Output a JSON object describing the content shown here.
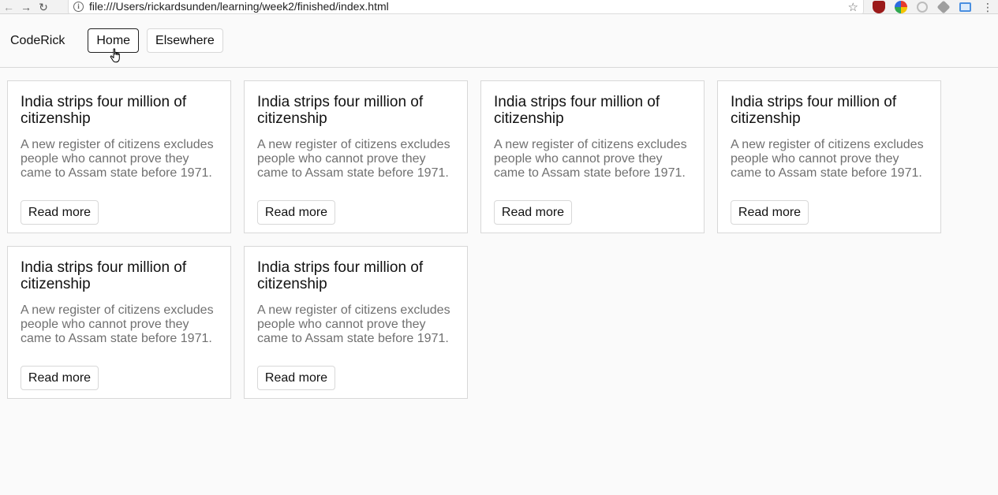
{
  "browser": {
    "url": "file:///Users/rickardsunden/learning/week2/finished/index.html",
    "back_icon": "arrow-left-icon",
    "forward_icon": "arrow-right-icon",
    "reload_icon": "reload-icon",
    "bookmark_icon": "star-icon",
    "menu_icon": "more-vert-icon",
    "extensions": [
      "ublock-icon",
      "color-picker-icon",
      "circle-extension-icon",
      "layers-extension-icon",
      "screen-extension-icon"
    ]
  },
  "header": {
    "brand": "CodeRick",
    "nav": [
      {
        "label": "Home",
        "active": true
      },
      {
        "label": "Elsewhere",
        "active": false
      }
    ]
  },
  "cards": [
    {
      "title": "India strips four million of citizenship",
      "text": "A new register of citizens excludes people who cannot prove they came to Assam state before 1971.",
      "button": "Read more"
    },
    {
      "title": "India strips four million of citizenship",
      "text": "A new register of citizens excludes people who cannot prove they came to Assam state before 1971.",
      "button": "Read more"
    },
    {
      "title": "India strips four million of citizenship",
      "text": "A new register of citizens excludes people who cannot prove they came to Assam state before 1971.",
      "button": "Read more"
    },
    {
      "title": "India strips four million of citizenship",
      "text": "A new register of citizens excludes people who cannot prove they came to Assam state before 1971.",
      "button": "Read more"
    },
    {
      "title": "India strips four million of citizenship",
      "text": "A new register of citizens excludes people who cannot prove they came to Assam state before 1971.",
      "button": "Read more"
    },
    {
      "title": "India strips four million of citizenship",
      "text": "A new register of citizens excludes people who cannot prove they came to Assam state before 1971.",
      "button": "Read more"
    }
  ],
  "colors": {
    "background": "#fafafa",
    "card_border": "#d8d8d8",
    "muted_text": "#707070",
    "active_border": "#222222"
  }
}
